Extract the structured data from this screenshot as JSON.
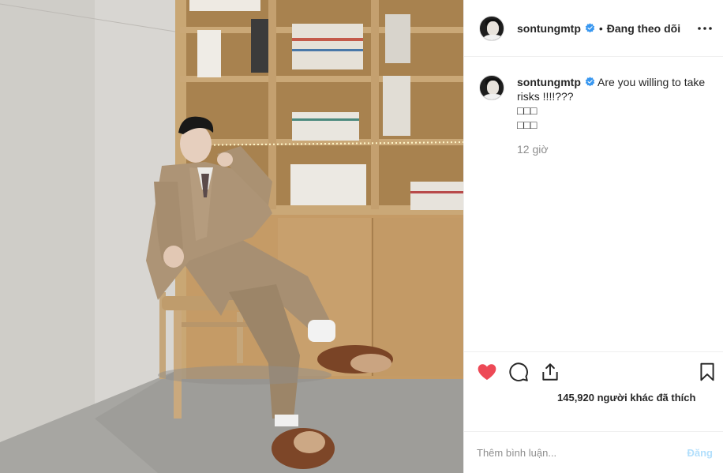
{
  "header": {
    "username": "sontungmtp",
    "separator": "•",
    "follow_status": "Đang theo dõi"
  },
  "caption": {
    "username": "sontungmtp",
    "lines": [
      "Are you willing to take risks !!!!???",
      "□□□",
      "□□□"
    ],
    "time_ago": "12 giờ"
  },
  "actions": {
    "likes_text": "145,920 người khác đã thích"
  },
  "comment": {
    "placeholder": "Thêm bình luận...",
    "post_label": "Đăng"
  },
  "icons": {
    "like": "heart-icon",
    "comment": "comment-icon",
    "share": "share-icon",
    "save": "bookmark-icon",
    "more": "more-options-icon",
    "verified": "verified-badge-icon"
  },
  "colors": {
    "like_active": "#ed4956",
    "verified": "#3897f0",
    "post_disabled": "#b2dffc",
    "muted_text": "#8e8e8e"
  }
}
